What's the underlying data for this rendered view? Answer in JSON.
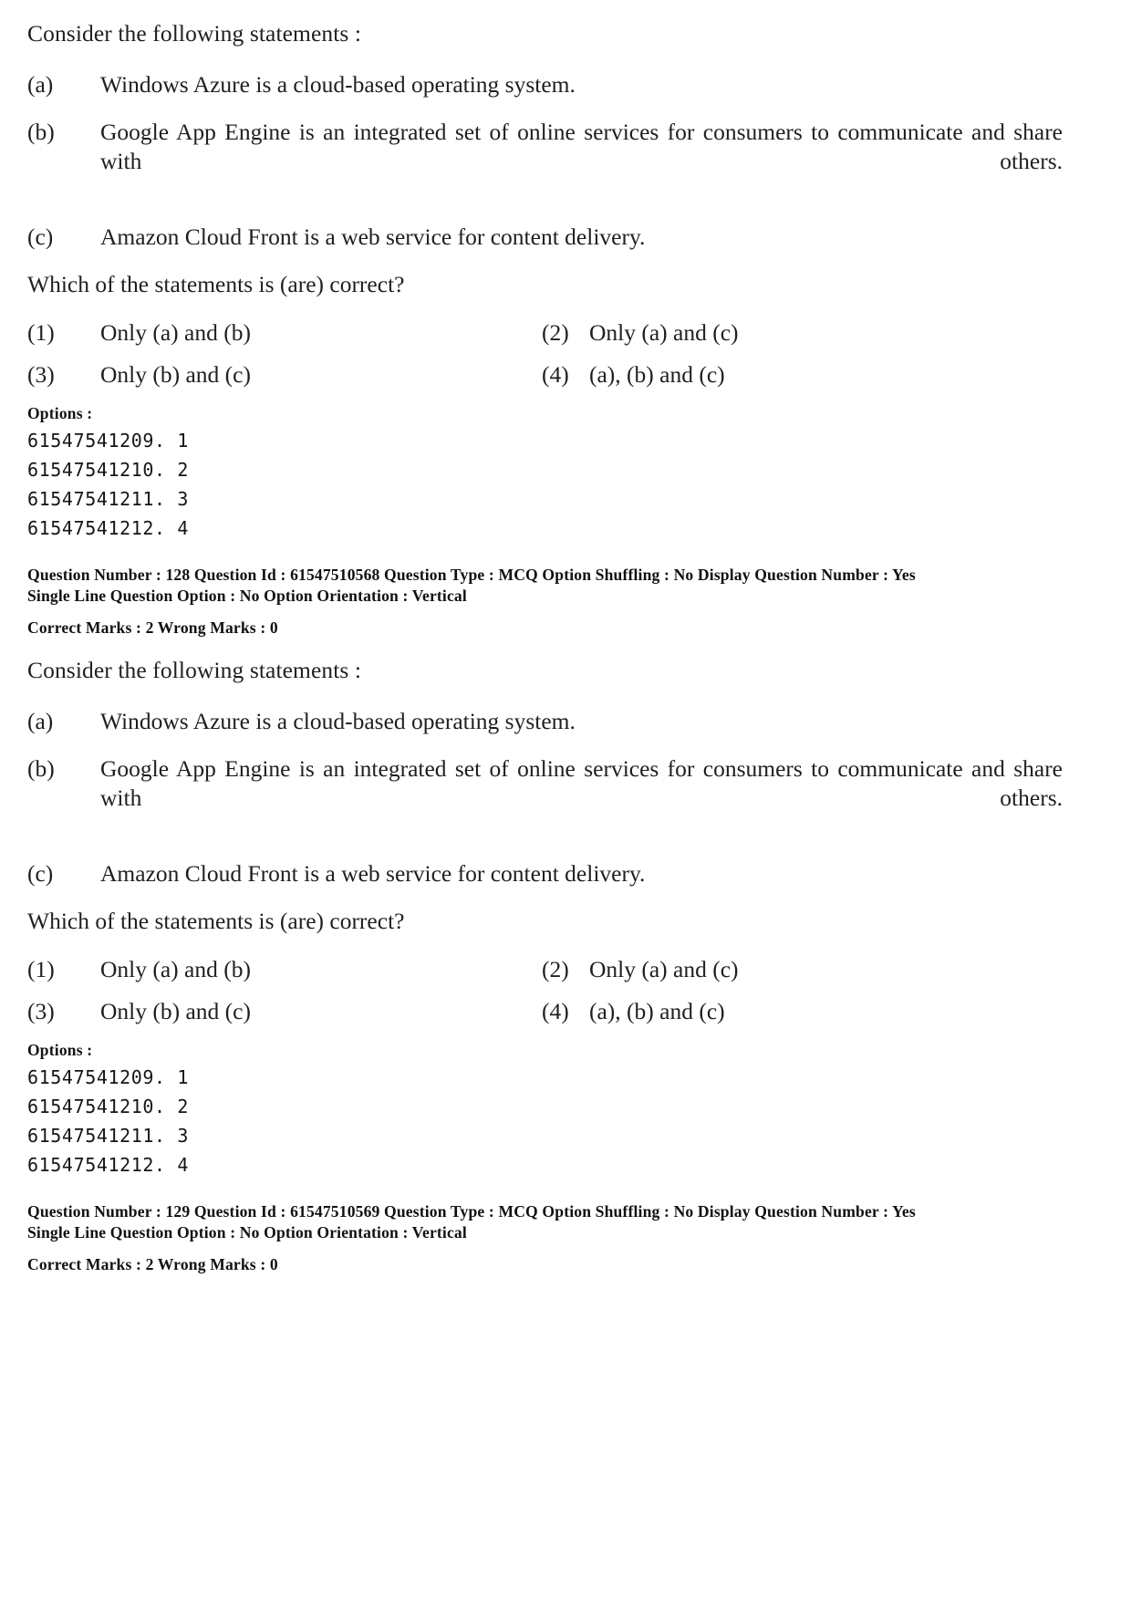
{
  "document": {
    "type": "exam-question-paper",
    "questions": [
      {
        "stem": "Consider the following statements :",
        "statements": [
          {
            "label": "(a)",
            "text": "Windows Azure is a cloud-based operating system."
          },
          {
            "label": "(b)",
            "text": "Google App Engine is an integrated set of online services for consumers to communicate and share with others."
          },
          {
            "label": "(c)",
            "text": "Amazon Cloud Front is a web service for content delivery."
          }
        ],
        "lead_question": "Which of the statements is (are) correct?",
        "choices": [
          {
            "num": "(1)",
            "text": "Only (a) and (b)"
          },
          {
            "num": "(2)",
            "text": "Only (a) and (c)"
          },
          {
            "num": "(3)",
            "text": "Only (b) and (c)"
          },
          {
            "num": "(4)",
            "text": "(a), (b) and (c)"
          }
        ],
        "options_label": "Options :",
        "option_ids": [
          "61547541209. 1",
          "61547541210. 2",
          "61547541211. 3",
          "61547541212. 4"
        ],
        "meta": {
          "line1": "Question Number : 128  Question Id : 61547510568  Question Type : MCQ  Option Shuffling : No  Display Question Number : Yes",
          "line2": "Single Line Question Option : No  Option Orientation : Vertical",
          "line3": "Correct Marks : 2  Wrong Marks : 0"
        }
      },
      {
        "stem": "Consider the following statements :",
        "statements": [
          {
            "label": "(a)",
            "text": "Windows Azure is a cloud-based operating system."
          },
          {
            "label": "(b)",
            "text": "Google App Engine is an integrated set of online services for consumers to communicate and share with others."
          },
          {
            "label": "(c)",
            "text": "Amazon Cloud Front is a web service for content delivery."
          }
        ],
        "lead_question": "Which of the statements is (are) correct?",
        "choices": [
          {
            "num": "(1)",
            "text": "Only (a) and (b)"
          },
          {
            "num": "(2)",
            "text": "Only (a) and (c)"
          },
          {
            "num": "(3)",
            "text": "Only (b) and (c)"
          },
          {
            "num": "(4)",
            "text": "(a), (b) and (c)"
          }
        ],
        "options_label": "Options :",
        "option_ids": [
          "61547541209. 1",
          "61547541210. 2",
          "61547541211. 3",
          "61547541212. 4"
        ],
        "meta": {
          "line1": "Question Number : 129  Question Id : 61547510569  Question Type : MCQ  Option Shuffling : No  Display Question Number : Yes",
          "line2": "Single Line Question Option : No  Option Orientation : Vertical",
          "line3": "Correct Marks : 2  Wrong Marks : 0"
        }
      }
    ]
  }
}
